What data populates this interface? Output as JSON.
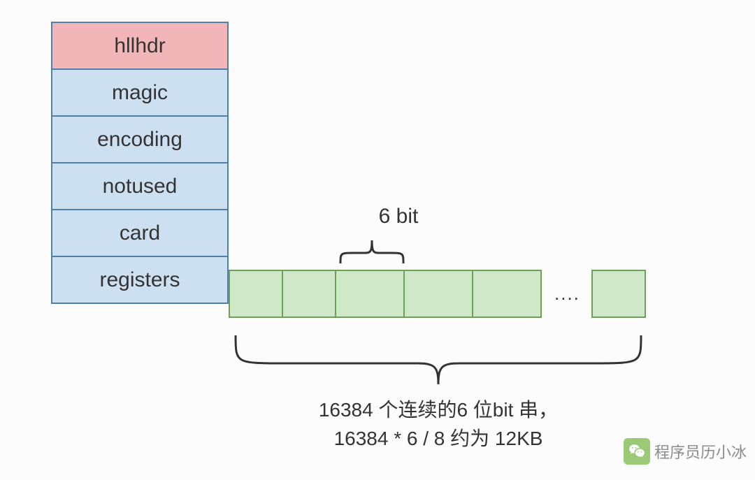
{
  "struct": {
    "header": "hllhdr",
    "fields": [
      "magic",
      "encoding",
      "notused",
      "card",
      "registers"
    ]
  },
  "bit_label": "6 bit",
  "ellipsis": "....",
  "bottom_text_line1": "16384 个连续的6 位bit 串，",
  "bottom_text_line2": "16384 * 6 / 8 约为 12KB",
  "watermark": "程序员历小冰"
}
